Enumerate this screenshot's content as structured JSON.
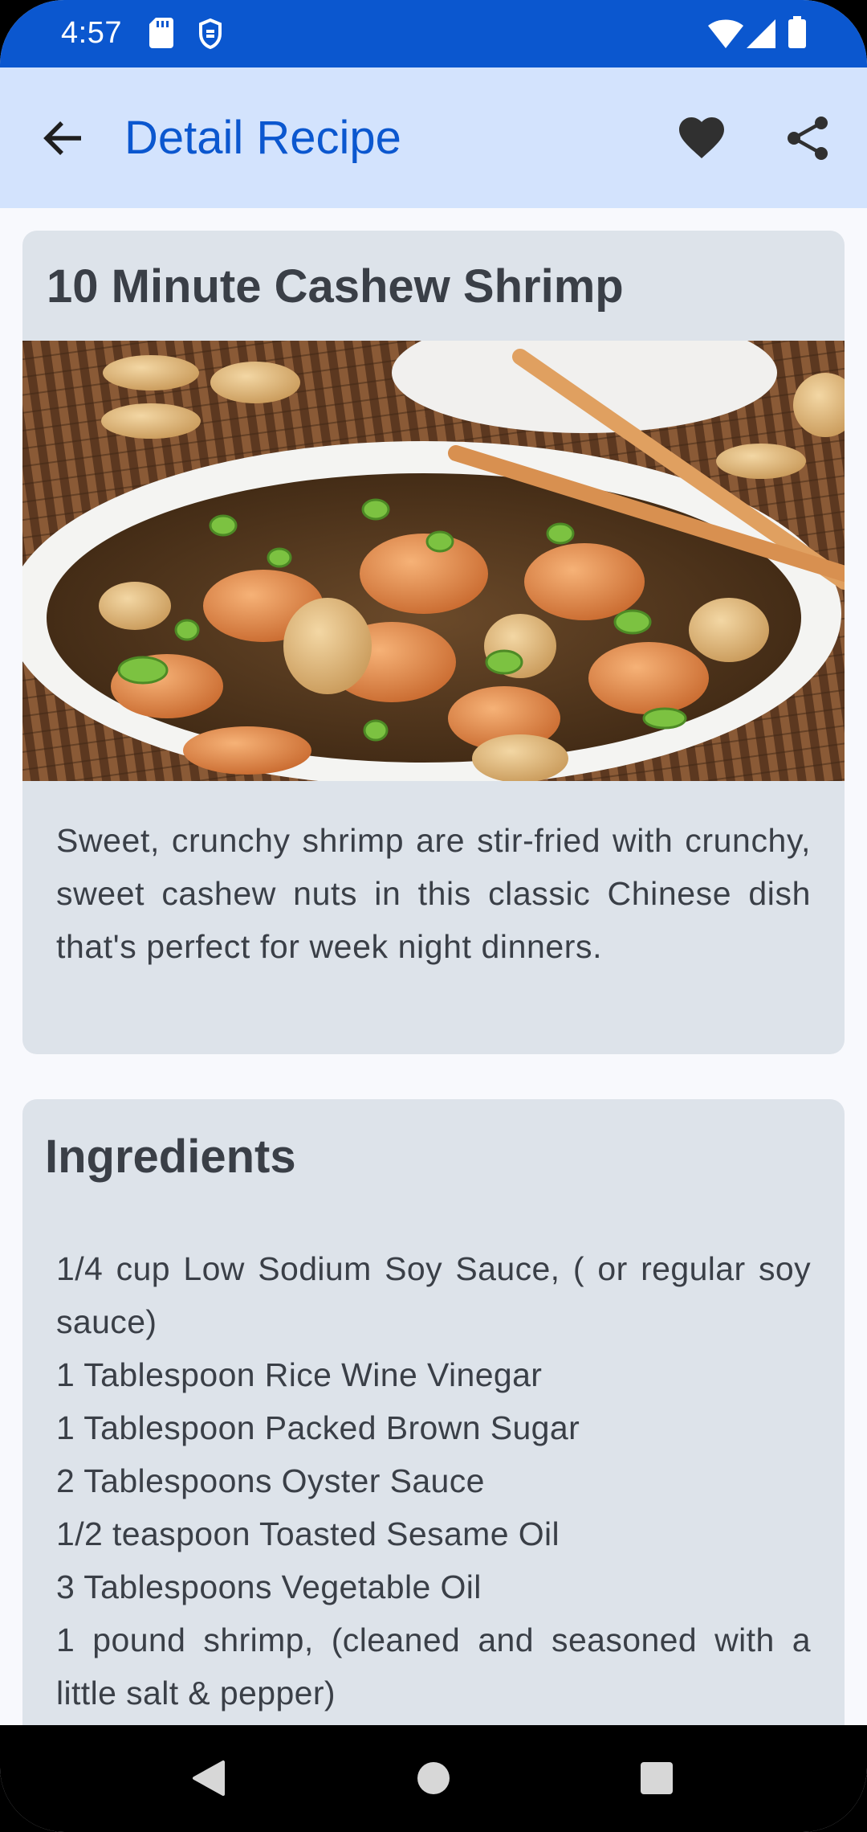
{
  "status_bar": {
    "time": "4:57",
    "icons": [
      "sd-card-icon",
      "vpn-key-icon",
      "wifi-icon",
      "signal-icon",
      "battery-icon"
    ]
  },
  "app_bar": {
    "title": "Detail Recipe",
    "back_icon": "arrow-back-icon",
    "favorite_icon": "heart-icon",
    "share_icon": "share-icon"
  },
  "recipe": {
    "title": "10 Minute Cashew Shrimp",
    "image_alt": "cashew shrimp dish",
    "description": "Sweet, crunchy shrimp are stir-fried with crunchy, sweet cashew nuts in this classic Chinese dish that's perfect for week night dinners."
  },
  "ingredients": {
    "title": "Ingredients",
    "items": [
      "1/4 cup Low Sodium Soy Sauce, ( or regular soy sauce)",
      "1 Tablespoon Rice Wine Vinegar",
      "1 Tablespoon Packed Brown Sugar",
      "2 Tablespoons Oyster Sauce",
      "1/2 teaspoon Toasted Sesame Oil",
      "3 Tablespoons Vegetable Oil",
      "1 pound shrimp, (cleaned and seasoned with a little salt & pepper)"
    ]
  },
  "nav_bar": {
    "icons": [
      "back-triangle-icon",
      "home-circle-icon",
      "recents-square-icon"
    ]
  },
  "colors": {
    "status_bar": "#0b57cf",
    "app_bar": "#d3e3fd",
    "title_accent": "#0b57cf",
    "card_bg": "#dde3ea",
    "text": "#3a3f47"
  }
}
